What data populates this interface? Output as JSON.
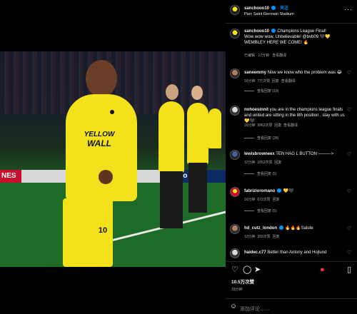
{
  "post": {
    "author": "sanchooo10",
    "follow_label": "关注",
    "location": "Parc Saint Germain Stadium",
    "caption_author": "sanchooo10",
    "caption_line1": "Champions League Final!",
    "caption_line2": "Wow wow wow, Unbelievable! @bvb09 🖤💛",
    "caption_line3": "WEMBLEY HERE WE COME! 🔥",
    "caption_meta": "已编辑 · 17分钟",
    "see_translation": "查看翻译",
    "likes": "10.5万次赞",
    "time_ago": "19分钟",
    "add_comment_placeholder": "添加评论……",
    "photo": {
      "ad_left": "NES",
      "ad_right": "opo",
      "shirt_line1": "YELLOW",
      "shirt_line2": "WALL",
      "number": "10"
    }
  },
  "comments": [
    {
      "user": "saneemmy",
      "text": "Now we know who the problem was 😂",
      "time": "16分钟",
      "likes": "7万次赞",
      "reply": "回复",
      "translate": "查看翻译",
      "view_replies": "查看回复 (19)"
    },
    {
      "user": "nohoesinnit",
      "text": "you are in the champions league finals and united are sitting in the 8th position , stay with us 💛🖤",
      "time": "16分钟",
      "likes": "9962次赞",
      "reply": "回复",
      "translate": "查看翻译",
      "view_replies": "查看回复 (28)"
    },
    {
      "user": "lewisbrowneex",
      "text": "TEN HAG L BUTTON ———>",
      "time": "12分钟",
      "likes": "1652次赞",
      "reply": "回复",
      "translate": "",
      "view_replies": "查看回复 (5)"
    },
    {
      "user": "fabrizioromano",
      "text": "💛🖤",
      "time": "16分钟",
      "likes": "672次赞",
      "reply": "回复",
      "translate": "",
      "view_replies": "查看回复 (5)"
    },
    {
      "user": "hd_cutz_london",
      "text": "🔥🔥🔥Salute",
      "time": "13分钟",
      "likes": "393次赞",
      "reply": "回复",
      "translate": "",
      "view_replies": ""
    },
    {
      "user": "haidec.c77",
      "text": "Better than Antony and Hojlund",
      "time": "",
      "likes": "",
      "reply": "",
      "translate": "",
      "view_replies": ""
    }
  ],
  "actions": {
    "like_icon": "heart-icon",
    "comment_icon": "comment-icon",
    "share_icon": "send-icon",
    "save_icon": "bookmark-icon",
    "more_icon": "more-icon"
  },
  "colors": {
    "background": "#000000",
    "accent": "#0095f6",
    "shirt": "#f3e21a"
  }
}
